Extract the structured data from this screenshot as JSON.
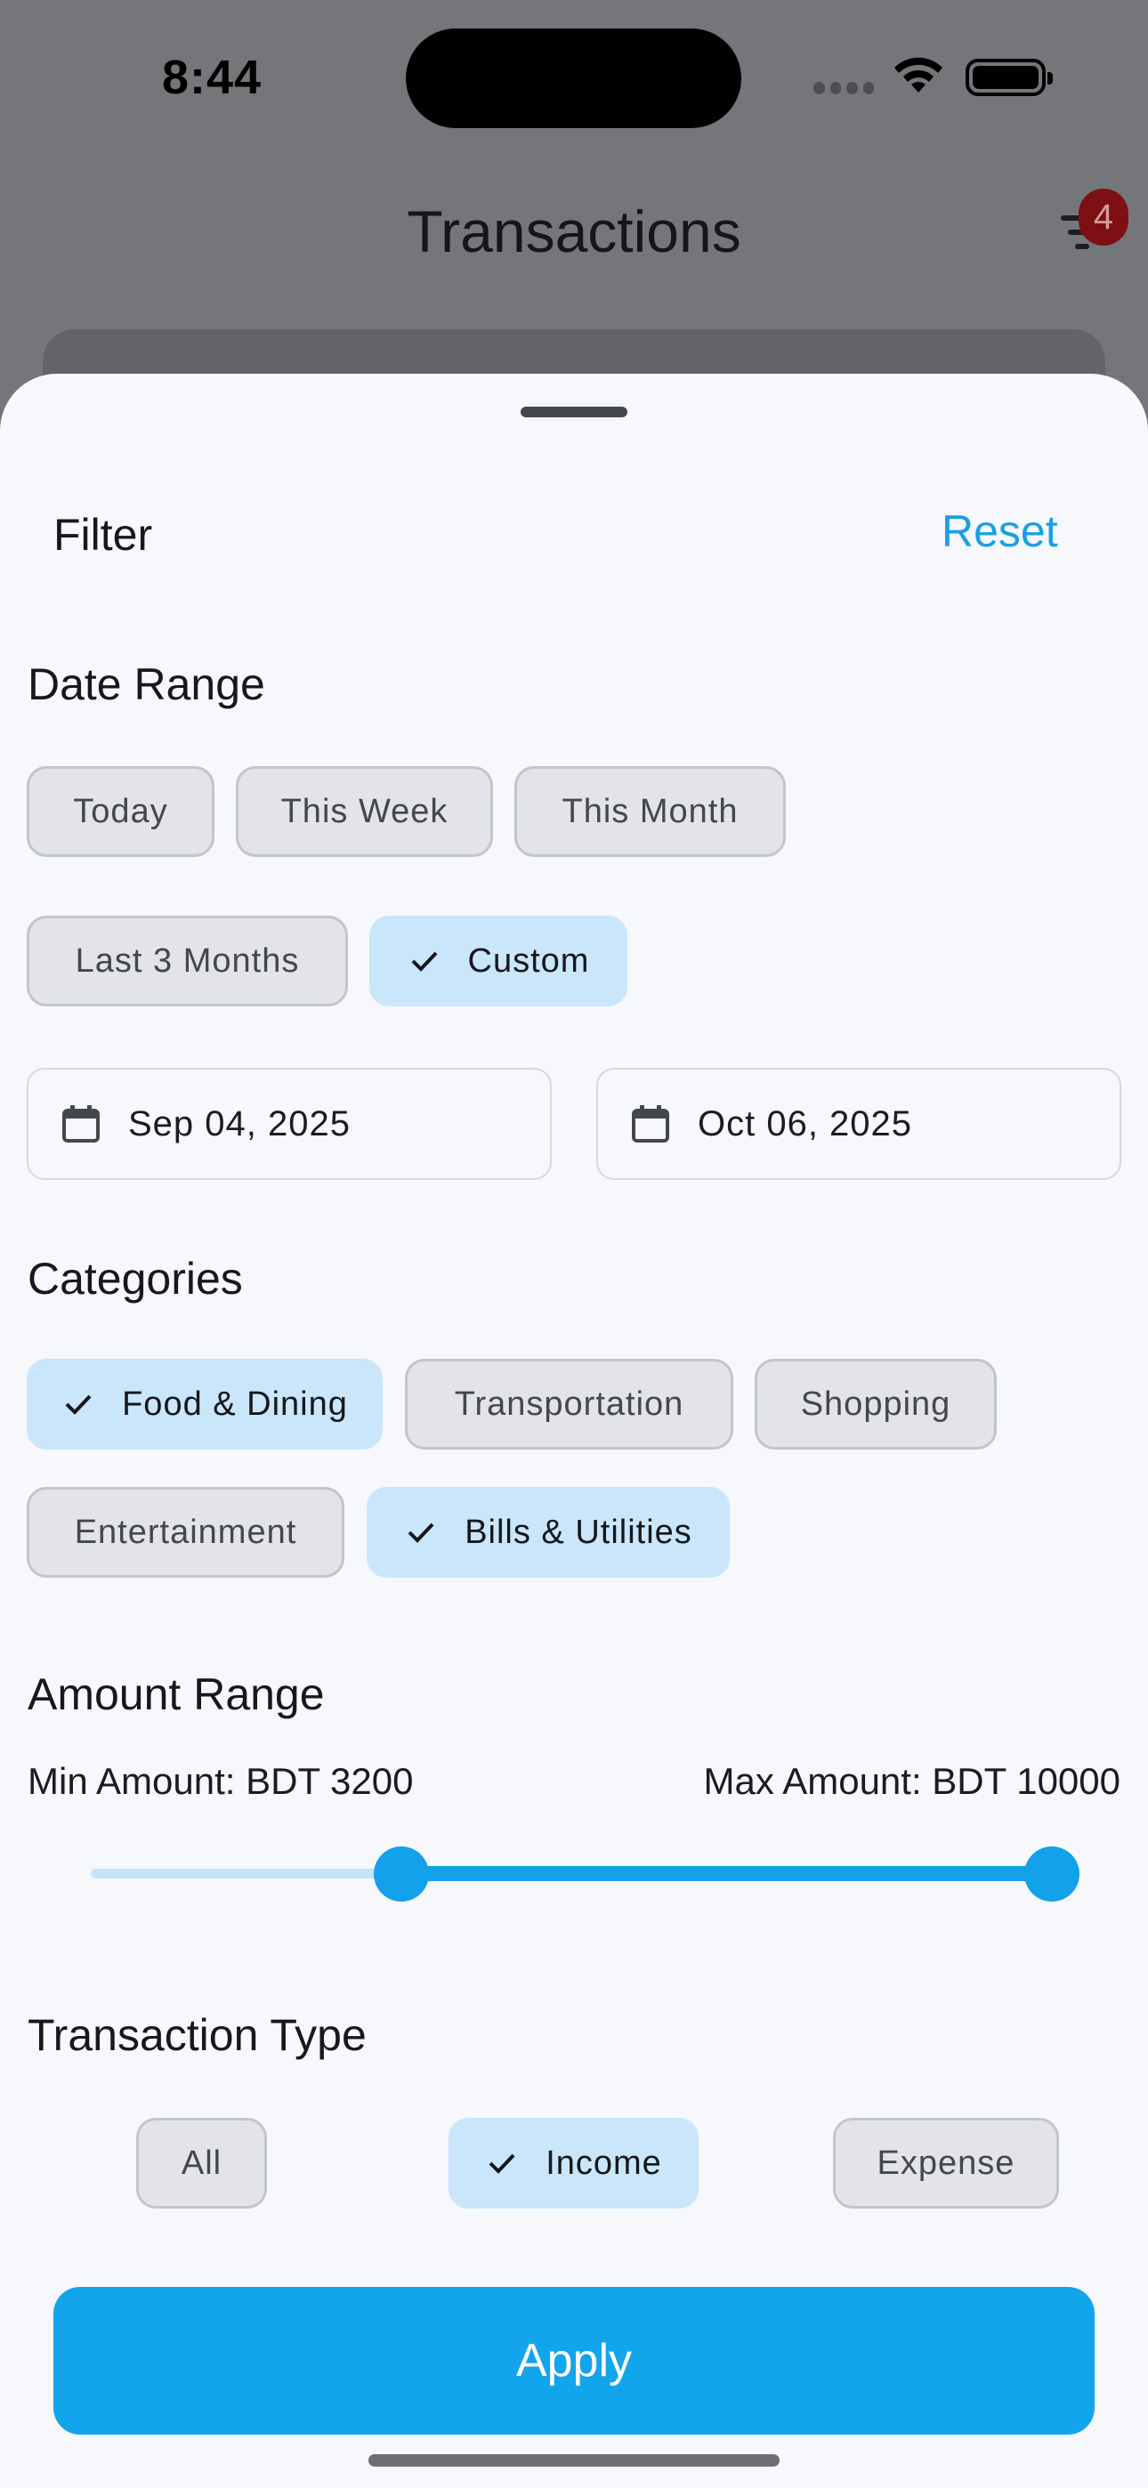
{
  "status_bar": {
    "time": "8:44"
  },
  "background": {
    "title": "Transactions",
    "notification_count": "4"
  },
  "sheet": {
    "title": "Filter",
    "reset_label": "Reset",
    "date_range": {
      "title": "Date Range",
      "chips": [
        {
          "label": "Today",
          "selected": false
        },
        {
          "label": "This Week",
          "selected": false
        },
        {
          "label": "This Month",
          "selected": false
        },
        {
          "label": "Last 3 Months",
          "selected": false
        },
        {
          "label": "Custom",
          "selected": true
        }
      ],
      "start_date": "Sep 04, 2025",
      "end_date": "Oct 06, 2025"
    },
    "categories": {
      "title": "Categories",
      "chips": [
        {
          "label": "Food & Dining",
          "selected": true
        },
        {
          "label": "Transportation",
          "selected": false
        },
        {
          "label": "Shopping",
          "selected": false
        },
        {
          "label": "Entertainment",
          "selected": false
        },
        {
          "label": "Bills & Utilities",
          "selected": true
        }
      ]
    },
    "amount_range": {
      "title": "Amount Range",
      "min_label": "Min Amount: BDT 3200",
      "max_label": "Max Amount: BDT 10000"
    },
    "transaction_type": {
      "title": "Transaction Type",
      "chips": [
        {
          "label": "All",
          "selected": false
        },
        {
          "label": "Income",
          "selected": true
        },
        {
          "label": "Expense",
          "selected": false
        }
      ]
    },
    "apply_label": "Apply"
  },
  "colors": {
    "accent": "#13a1ea",
    "selected_chip": "#cae6fb",
    "chip": "#e2e4e8"
  }
}
